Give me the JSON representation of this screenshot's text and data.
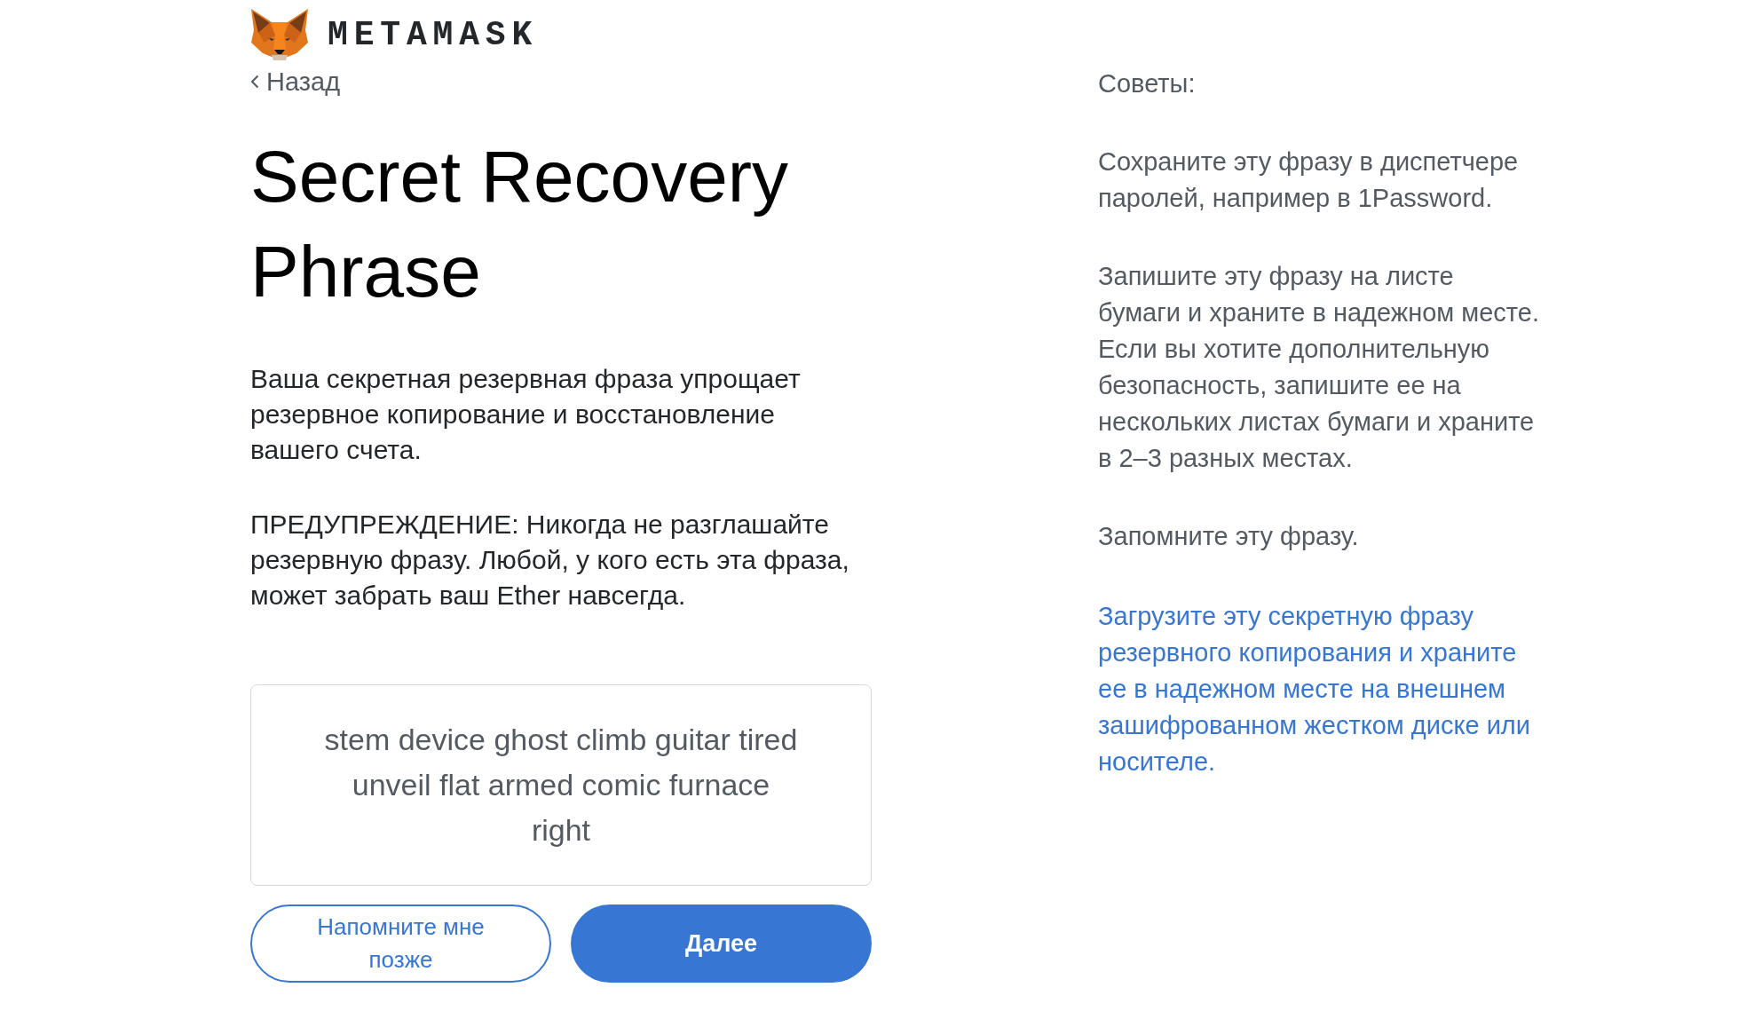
{
  "header": {
    "logo_text": "METAMASK",
    "back_link": "Назад"
  },
  "title": "Secret Recovery Phrase",
  "description": "Ваша секретная резервная фраза упрощает резервное копирование и восстановление вашего счета.",
  "warning": "ПРЕДУПРЕЖДЕНИЕ: Никогда не разглашайте резервную фразу. Любой, у кого есть эта фраза, может забрать ваш Ether навсегда.",
  "recovery_phrase": "stem device ghost climb guitar tired unveil flat armed comic furnace right",
  "actions": [
    {
      "label": "Напомните мне позже",
      "kind": "secondary"
    },
    {
      "label": "Далее",
      "kind": "primary"
    }
  ],
  "tips": {
    "heading": "Советы:",
    "items": [
      {
        "kind": "text",
        "text": "Сохраните эту фразу в диспетчере паролей, например в 1Password."
      },
      {
        "kind": "text",
        "text": "Запишите эту фразу на листе бумаги и храните в надежном месте. Если вы хотите дополнительную безопасность, запишите ее на нескольких листах бумаги и храните в 2–3 разных местах."
      },
      {
        "kind": "text",
        "text": "Запомните эту фразу."
      },
      {
        "kind": "link",
        "text": "Загрузите эту секретную фразу резервного копирования и храните ее в надежном месте на внешнем зашифрованном жестком диске или носителе."
      }
    ]
  }
}
